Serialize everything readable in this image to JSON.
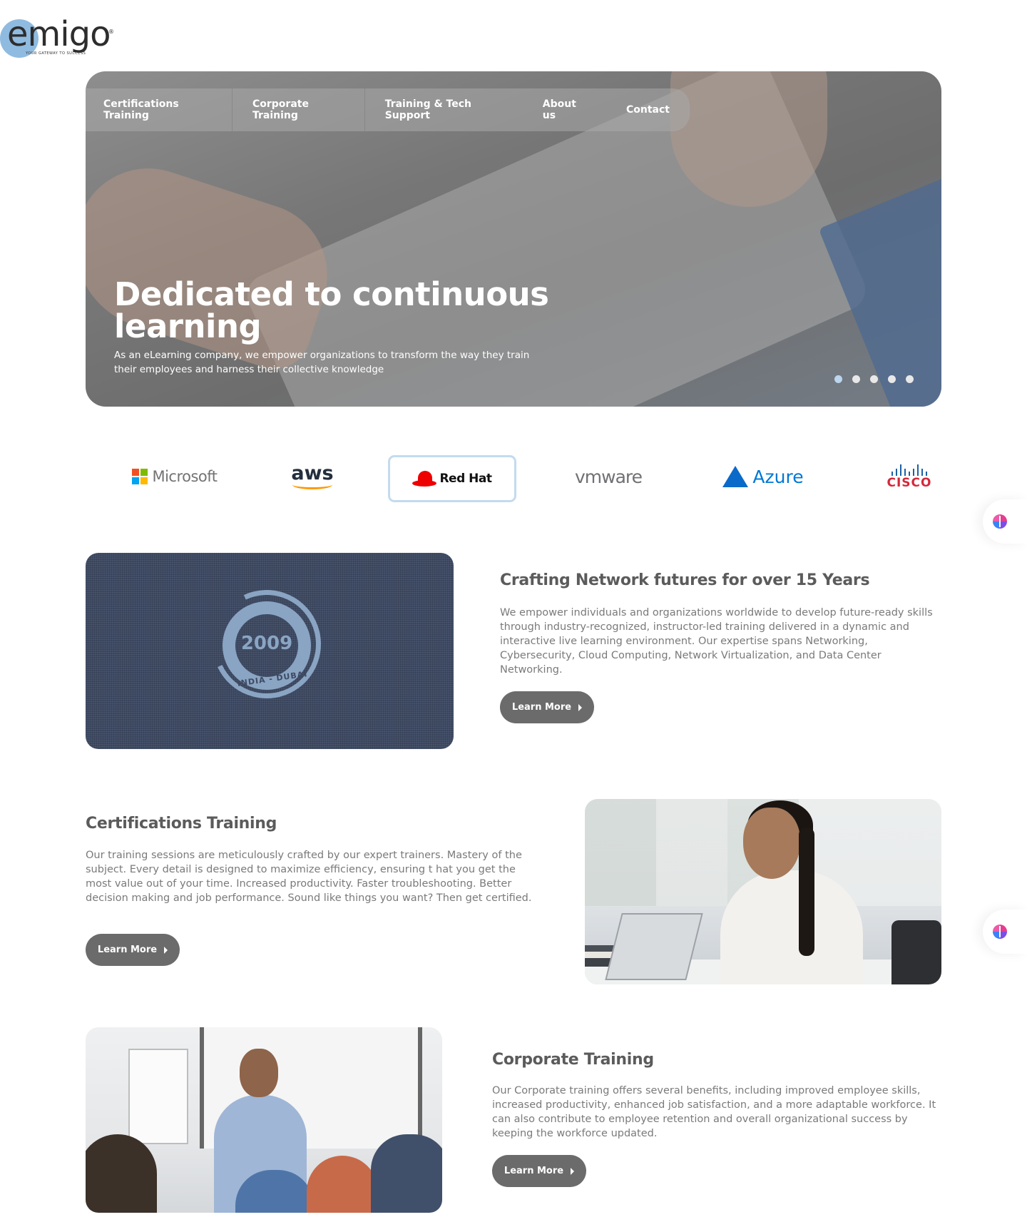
{
  "brand": {
    "logo_text": "emigo",
    "registered": "®",
    "tagline": "YOUR GATEWAY TO SUCCESS"
  },
  "nav": {
    "items": [
      {
        "label": "Certifications Training"
      },
      {
        "label": "Corporate Training"
      },
      {
        "label": "Training & Tech  Support"
      },
      {
        "label": "About us"
      },
      {
        "label": "Contact"
      }
    ]
  },
  "hero": {
    "title": "Dedicated to continuous learning",
    "subtitle": "As an eLearning company, we empower organizations to transform the way they train their employees and harness their collective knowledge",
    "slides_total": 5,
    "active_slide": 1,
    "active_dot_color": "#bcd6ee"
  },
  "partners": {
    "items": [
      {
        "name": "Microsoft",
        "icon": "microsoft-logo"
      },
      {
        "name": "aws",
        "icon": "aws-logo"
      },
      {
        "name": "Red Hat",
        "icon": "redhat-logo",
        "selected": true
      },
      {
        "name": "vmware",
        "icon": "vmware-logo"
      },
      {
        "name": "Azure",
        "icon": "azure-logo"
      },
      {
        "name": "CISCO",
        "icon": "cisco-logo"
      }
    ]
  },
  "side_widgets": [
    {
      "icon": "ai-brain-icon"
    },
    {
      "icon": "ai-brain-icon"
    }
  ],
  "about": {
    "badge_year": "2009",
    "badge_location": "INDIA - DUBAI",
    "title": "Crafting Network futures for over 15 Years",
    "text": "We empower individuals and organizations worldwide to develop future-ready skills through industry-recognized, instructor-led training delivered in a dynamic and interactive live learning environment. Our expertise spans Networking, Cybersecurity, Cloud Computing, Network Virtualization, and Data Center Networking.",
    "button": "Learn More"
  },
  "certifications": {
    "title": "Certifications Training",
    "text": "Our training sessions are meticulously crafted by our expert trainers. Mastery of the subject. Every detail is designed to maximize efficiency, ensuring t hat you get the most value out of your time. Increased productivity. Faster troubleshooting. Better decision making and job performance. Sound like things you want? Then get certified.",
    "button": "Learn More"
  },
  "corporate": {
    "title": "Corporate Training",
    "text": "Our Corporate training offers several benefits, including improved employee skills, increased productivity, enhanced job satisfaction, and a more adaptable workforce. It can also contribute to employee retention and overall organizational success by keeping the workforce updated.",
    "button": "Learn More"
  },
  "colors": {
    "button_bg": "#6b6b6b",
    "heading": "#5b5b5b",
    "body_text": "#7a7a7a",
    "logo_blue": "#8fbbe0"
  }
}
